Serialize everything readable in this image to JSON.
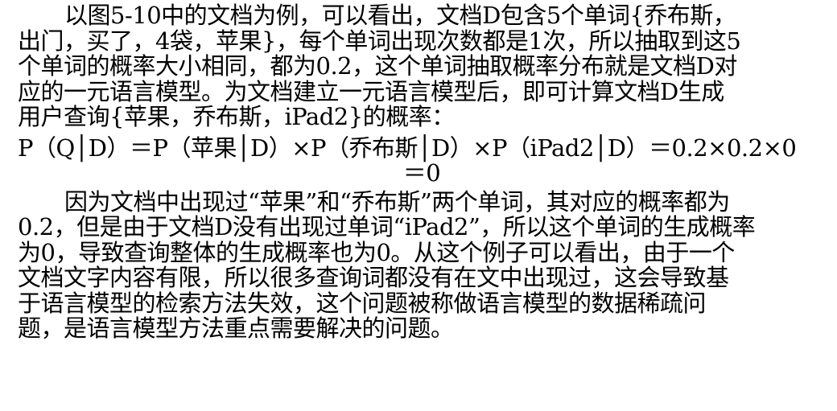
{
  "paragraph1": {
    "lines": [
      "以图5-10中的文档为例，可以看出，文档D包含5个单词{乔布斯，",
      "出门，买了，4袋，苹果}，每个单词出现次数都是1次，所以抽取到这5",
      "个单词的概率大小相同，都为0.2，这个单词抽取概率分布就是文档D对",
      "应的一元语言模型。为文档建立一元语言模型后，即可计算文档D生成",
      "用户查询{苹果，乔布斯，iPad2}的概率："
    ]
  },
  "formula": {
    "line1": "P（Q│D）＝P（苹果│D）×P（乔布斯│D）×P（iPad2│D）＝0.2×0.2×0",
    "line2": "＝0"
  },
  "paragraph2": {
    "lines": [
      "因为文档中出现过“苹果”和“乔布斯”两个单词，其对应的概率都为",
      "0.2，但是由于文档D没有出现过单词“iPad2”，所以这个单词的生成概率",
      "为0，导致查询整体的生成概率也为0。从这个例子可以看出，由于一个",
      "文档文字内容有限，所以很多查询词都没有在文中出现过，这会导致基",
      "于语言模型的检索方法失效，这个问题被称做语言模型的数据稀疏问",
      "题，是语言模型方法重点需要解决的问题。"
    ]
  }
}
